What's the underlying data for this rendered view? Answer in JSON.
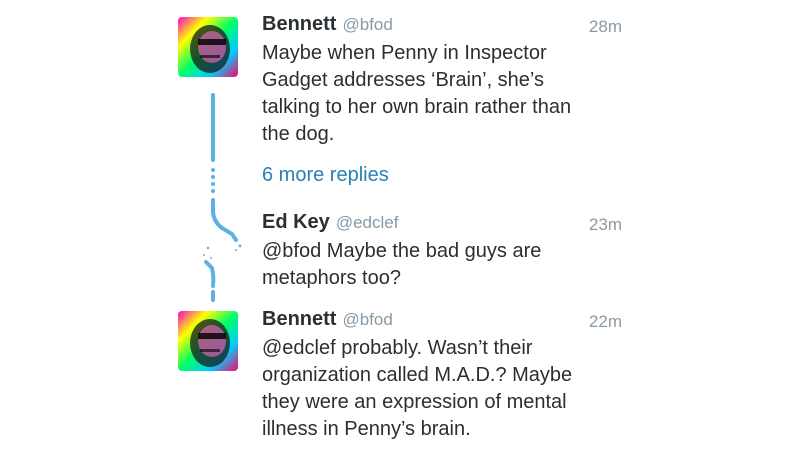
{
  "tweets": [
    {
      "author": "Bennett",
      "handle": "@bfod",
      "time": "28m",
      "lines": [
        "Maybe when Penny in Inspector",
        "Gadget addresses ‘Brain’, she’s",
        "talking to her own brain rather than",
        "the dog."
      ]
    },
    {
      "author": "Ed Key",
      "handle": "@edclef",
      "time": "23m",
      "lines": [
        "@bfod Maybe the bad guys are",
        "metaphors too?"
      ]
    },
    {
      "author": "Bennett",
      "handle": "@bfod",
      "time": "22m",
      "lines": [
        "@edclef probably. Wasn’t their",
        "organization called M.A.D.? Maybe",
        "they were an expression of mental",
        "illness in Penny’s brain."
      ]
    }
  ],
  "more_replies": "6 more replies",
  "colors": {
    "thread_line": "#5bb0e6",
    "link": "#2a7fb8",
    "meta": "#8899a6",
    "text": "#292f33"
  },
  "icons": {
    "avatar": "rainbow-portrait-avatar"
  }
}
